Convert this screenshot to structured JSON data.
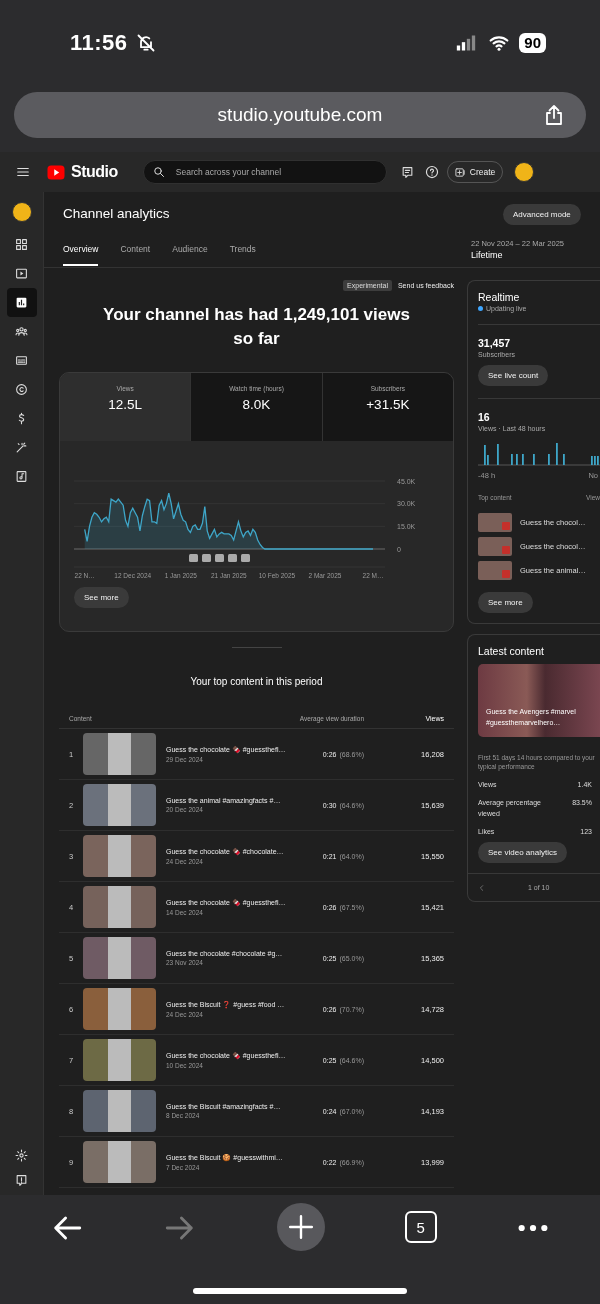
{
  "status_bar": {
    "time": "11:56",
    "battery": "90"
  },
  "browser_bar": {
    "url": "studio.youtube.com"
  },
  "top_bar": {
    "logo_text": "Studio",
    "search": {
      "placeholder": "Search across your channel"
    },
    "create_button": "Create"
  },
  "rail": {
    "items": [
      {
        "selected": false
      },
      {
        "selected": false
      },
      {
        "selected": true
      },
      {
        "selected": false
      },
      {
        "selected": false
      },
      {
        "selected": false
      },
      {
        "selected": false
      },
      {
        "selected": false
      },
      {
        "selected": false
      }
    ]
  },
  "header": {
    "title": "Channel analytics",
    "advanced_button": "Advanced mode",
    "tabs": [
      {
        "label": "Overview",
        "selected": true
      },
      {
        "label": "Content",
        "selected": false
      },
      {
        "label": "Audience",
        "selected": false
      },
      {
        "label": "Trends",
        "selected": false
      }
    ],
    "date_range": "22 Nov 2024 – 22 Mar 2025",
    "period": "Lifetime"
  },
  "overview": {
    "badge": "Experimental",
    "feedback_link": "Send us feedback",
    "headline": "Your channel has had 1,249,101 views so far",
    "metrics": [
      {
        "label": "Views",
        "value": "12.5L",
        "selected": true
      },
      {
        "label": "Watch time (hours)",
        "value": "8.0K",
        "selected": false
      },
      {
        "label": "Subscribers",
        "value": "+31.5K",
        "selected": false
      }
    ],
    "chart_data": {
      "type": "line",
      "ylim": [
        0,
        45
      ],
      "categories": [
        "22 N…",
        null,
        null,
        null,
        null,
        null,
        null,
        null,
        null,
        null,
        null,
        null,
        null,
        null,
        null,
        null,
        null,
        null,
        null,
        null,
        "12 Dec 2024",
        null,
        null,
        null,
        null,
        null,
        null,
        null,
        null,
        null,
        null,
        null,
        null,
        null,
        null,
        null,
        null,
        null,
        null,
        null,
        "1 Jan 2025",
        null,
        null,
        null,
        null,
        null,
        null,
        null,
        null,
        null,
        null,
        null,
        null,
        null,
        null,
        null,
        null,
        null,
        null,
        null,
        "21 Jan 2025",
        null,
        null,
        null,
        null,
        null,
        null,
        null,
        null,
        null,
        null,
        null,
        null,
        null,
        null,
        null,
        null,
        null,
        null,
        null,
        "10 Feb 2025",
        null,
        null,
        null,
        null,
        null,
        null,
        null,
        null,
        null,
        null,
        null,
        null,
        null,
        null,
        null,
        null,
        null,
        null,
        null,
        "2 Mar 2025",
        null,
        null,
        null,
        null,
        null,
        null,
        null,
        null,
        null,
        null,
        null,
        null,
        null,
        null,
        null,
        null,
        null,
        null,
        null,
        "22 M…"
      ],
      "series": [
        {
          "color": "#3ea6c8",
          "values": [
            13,
            5,
            15,
            21,
            24,
            23,
            21,
            18,
            20,
            21,
            18,
            33,
            32,
            31,
            33,
            31,
            29,
            19,
            15,
            24,
            27,
            24,
            21,
            12,
            22,
            28,
            33,
            32,
            18,
            18,
            17,
            29,
            32,
            26,
            30,
            37,
            30,
            20,
            25,
            30,
            23,
            19,
            18,
            13,
            11,
            15,
            16,
            13,
            13,
            17,
            28,
            12,
            7,
            10,
            13,
            8,
            10,
            11,
            10,
            10,
            10,
            9,
            6,
            12,
            18,
            12,
            8,
            11,
            12,
            9,
            13,
            11,
            6,
            3,
            1,
            0,
            0,
            0,
            0,
            0,
            0,
            0,
            0,
            0,
            0,
            0,
            0,
            0,
            0,
            0,
            0,
            0,
            0,
            0,
            0,
            0,
            0,
            0,
            0,
            0,
            0,
            0,
            0,
            0,
            0,
            0,
            0,
            0,
            0,
            0,
            0,
            0,
            0,
            0,
            0,
            0,
            0,
            0,
            0,
            0,
            0
          ]
        }
      ],
      "yticks": [
        {
          "value": 0,
          "label": "0"
        },
        {
          "value": 15,
          "label": "15.0K"
        },
        {
          "value": 30,
          "label": "30.0K"
        },
        {
          "value": 45,
          "label": "45.0K"
        }
      ]
    },
    "see_more": "See more"
  },
  "top_content": {
    "title": "Your top content in this period",
    "columns": [
      "Content",
      "Average view duration",
      "Views"
    ],
    "rows": [
      {
        "rank": "1",
        "title": "Guess the chocolate 🍫 #guessthefl…",
        "date": "29 Dec 2024",
        "duration": "0:26",
        "percent": "(68.6%)",
        "views": "16,208"
      },
      {
        "rank": "2",
        "title": "Guess the animal #amazingfacts #…",
        "date": "20 Dec 2024",
        "duration": "0:30",
        "percent": "(64.6%)",
        "views": "15,639"
      },
      {
        "rank": "3",
        "title": "Guess the chocolate 🍫 #chocolate…",
        "date": "24 Dec 2024",
        "duration": "0:21",
        "percent": "(64.0%)",
        "views": "15,550"
      },
      {
        "rank": "4",
        "title": "Guess the chocolate 🍫 #guessthefl…",
        "date": "14 Dec 2024",
        "duration": "0:26",
        "percent": "(67.5%)",
        "views": "15,421"
      },
      {
        "rank": "5",
        "title": "Guess the chocolate #chocolate #g…",
        "date": "23 Nov 2024",
        "duration": "0:25",
        "percent": "(65.0%)",
        "views": "15,365"
      },
      {
        "rank": "6",
        "title": "Guess the Biscuit ❓ #guess #food …",
        "date": "24 Dec 2024",
        "duration": "0:26",
        "percent": "(70.7%)",
        "views": "14,728"
      },
      {
        "rank": "7",
        "title": "Guess the chocolate 🍫 #guessthefl…",
        "date": "10 Dec 2024",
        "duration": "0:25",
        "percent": "(64.6%)",
        "views": "14,500"
      },
      {
        "rank": "8",
        "title": "Guess the Biscuit #amazingfacts #…",
        "date": "8 Dec 2024",
        "duration": "0:24",
        "percent": "(67.0%)",
        "views": "14,193"
      },
      {
        "rank": "9",
        "title": "Guess the Biscuit 🍪 #guesswithmi…",
        "date": "7 Dec 2024",
        "duration": "0:22",
        "percent": "(66.9%)",
        "views": "13,999"
      }
    ]
  },
  "realtime": {
    "title": "Realtime",
    "status": "Updating live",
    "subscribers": "31,457",
    "subscribers_label": "Subscribers",
    "live_count_button": "See live count",
    "views": "16",
    "views_label": "Views · Last 48 hours",
    "axis_start": "-48 h",
    "axis_end": "No",
    "top_content_label": "Top content",
    "views_column": "View",
    "items": [
      "Guess the chocol…",
      "Guess the chocol…",
      "Guess the animal…"
    ],
    "see_more": "See more"
  },
  "latest": {
    "title": "Latest content",
    "video_title": "Guess the Avengers #marvel #guessthemarvelhero…",
    "note": "First 51 days 14 hours compared to your typical performance",
    "stats": [
      {
        "label": "Views",
        "value": "1.4K"
      },
      {
        "label": "Average percentage viewed",
        "value": "83.5%"
      },
      {
        "label": "Likes",
        "value": "123"
      }
    ],
    "analytics_button": "See video analytics",
    "pager": "1 of 10"
  },
  "toolbar": {
    "tab_count": "5",
    "forward_disabled": true
  }
}
